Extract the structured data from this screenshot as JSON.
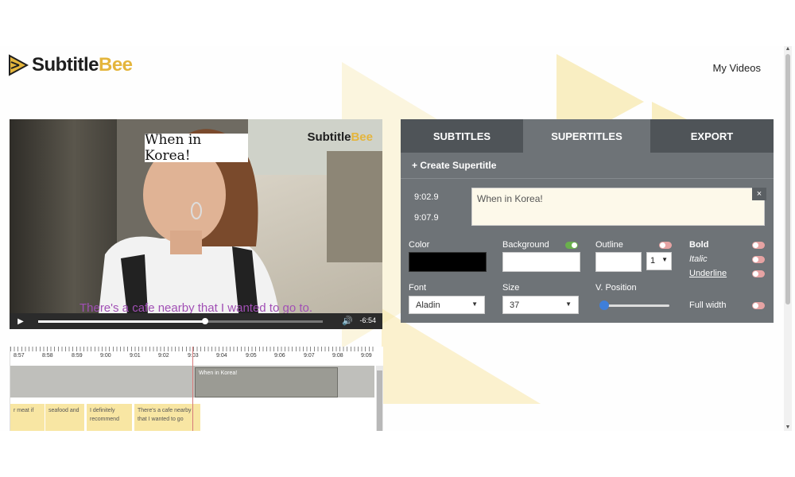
{
  "header": {
    "logo_part1": "Subtitle",
    "logo_part2": "Bee",
    "my_videos": "My Videos"
  },
  "video": {
    "caption_overlay": "When in Korea!",
    "watermark_part1": "Subtitle",
    "watermark_part2": "Bee",
    "subtitle": "There's a cafe nearby that I wanted to go to.",
    "time_remaining": "-6:54",
    "progress_fraction": 0.5
  },
  "timeline": {
    "ticks": [
      "8:57",
      "8:58",
      "8:59",
      "9:00",
      "9:01",
      "9:02",
      "9:03",
      "9:04",
      "9:05",
      "9:06",
      "9:07",
      "9:08",
      "9:09"
    ],
    "supertitle_block": "When in Korea!",
    "cues": [
      "r meat if",
      "seafood and",
      "I definitely recommend",
      "There's a cafe nearby that I wanted to go"
    ]
  },
  "panel": {
    "tabs": [
      "SUBTITLES",
      "SUPERTITLES",
      "EXPORT"
    ],
    "active_tab": "SUPERTITLES",
    "create_label": "+ Create Supertitle",
    "start_time": "9:02.9",
    "end_time": "9:07.9",
    "supertitle_text": "When in Korea!",
    "close": "×",
    "color_label": "Color",
    "background_label": "Background",
    "outline_label": "Outline",
    "outline_width": "1",
    "bold_label": "Bold",
    "italic_label": "Italic",
    "underline_label": "Underline",
    "font_label": "Font",
    "font_value": "Aladin",
    "size_label": "Size",
    "size_value": "37",
    "vposition_label": "V. Position",
    "fullwidth_label": "Full width",
    "colors": {
      "text": "#000000",
      "background": "#ffffff",
      "accent": "#e4b53c"
    },
    "toggles": {
      "background": true,
      "outline": false,
      "bold": false,
      "italic": false,
      "underline": false,
      "full_width": false
    },
    "vposition_fraction": 0.05
  }
}
